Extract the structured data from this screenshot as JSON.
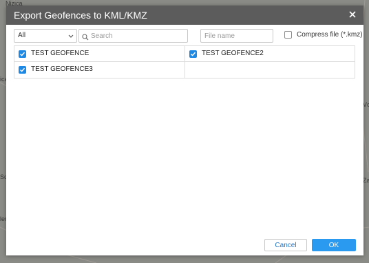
{
  "dialog": {
    "title": "Export Geofences to KML/KMZ",
    "close_icon": "close-icon"
  },
  "toolbar": {
    "filter_value": "All",
    "search_placeholder": "Search",
    "search_value": "",
    "filename_placeholder": "File name",
    "filename_value": "",
    "compress_label": "Compress file (*.kmz)",
    "compress_checked": false
  },
  "geofences": [
    {
      "name": "TEST GEOFENCE",
      "checked": true
    },
    {
      "name": "TEST GEOFENCE2",
      "checked": true
    },
    {
      "name": "TEST GEOFENCE3",
      "checked": true
    }
  ],
  "buttons": {
    "cancel": "Cancel",
    "ok": "OK"
  },
  "map": {
    "labels": [
      "Nizica",
      "ica",
      "Sc",
      "lern",
      "Za",
      "Vc"
    ]
  },
  "colors": {
    "titlebar": "#5c5c5c",
    "accent": "#2a9af0",
    "checkbox": "#1e88e5"
  }
}
